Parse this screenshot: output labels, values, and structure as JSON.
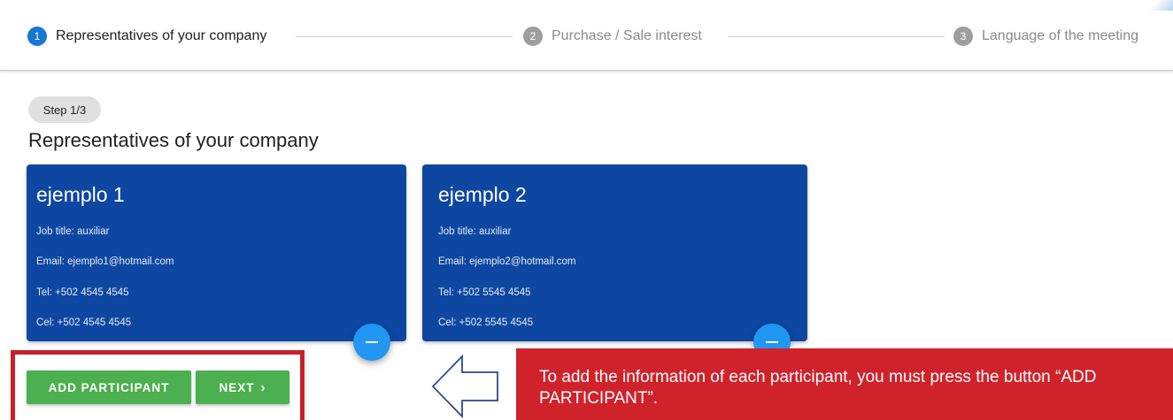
{
  "stepper": {
    "steps": [
      {
        "number": "1",
        "label": "Representatives of your company",
        "state": "active"
      },
      {
        "number": "2",
        "label": "Purchase / Sale interest",
        "state": "inactive"
      },
      {
        "number": "3",
        "label": "Language of the meeting",
        "state": "inactive"
      }
    ]
  },
  "step_chip": "Step 1/3",
  "section_title": "Representatives of your company",
  "participants": [
    {
      "name": "ejemplo 1",
      "job": "Job title: auxiliar",
      "email": "Email: ejemplo1@hotmail.com",
      "tel": "Tel: +502 4545 4545",
      "cel": "Cel: +502 4545 4545"
    },
    {
      "name": "ejemplo 2",
      "job": "Job title: auxiliar",
      "email": "Email: ejemplo2@hotmail.com",
      "tel": "Tel: +502 5545 4545",
      "cel": "Cel: +502 5545 4545"
    }
  ],
  "remove_icon": "minus-icon",
  "actions": {
    "add_participant": "ADD PARTICIPANT",
    "next": "NEXT",
    "next_icon": "chevron-right-icon"
  },
  "annotation": {
    "text": "To add the information of each participant, you must press the button “ADD PARTICIPANT”."
  },
  "colors": {
    "active_step": "#1976d2",
    "card": "#0d47a1",
    "fab": "#2196f3",
    "button": "#4caf50",
    "annotation": "#d0222b"
  }
}
